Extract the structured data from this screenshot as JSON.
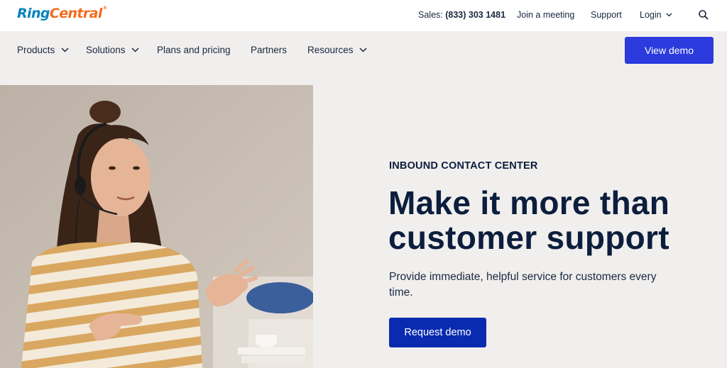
{
  "header": {
    "logo_ring": "Ring",
    "logo_central": "Central",
    "logo_reg": "®",
    "sales_label": "Sales:",
    "sales_phone": "(833) 303 1481",
    "join_meeting": "Join a meeting",
    "support": "Support",
    "login": "Login",
    "search_icon": "search-icon"
  },
  "nav": {
    "items": [
      {
        "label": "Products",
        "has_dropdown": true
      },
      {
        "label": "Solutions",
        "has_dropdown": true
      },
      {
        "label": "Plans and pricing",
        "has_dropdown": false
      },
      {
        "label": "Partners",
        "has_dropdown": false
      },
      {
        "label": "Resources",
        "has_dropdown": true
      }
    ],
    "cta": "View demo"
  },
  "hero": {
    "eyebrow": "INBOUND CONTACT CENTER",
    "headline": "Make it more than customer support",
    "subtext": "Provide immediate, helpful service for customers every time.",
    "cta": "Request demo"
  },
  "colors": {
    "brand_blue": "#0684bc",
    "brand_orange": "#f26b1d",
    "button_blue": "#2b3bdd",
    "cta_dark_blue": "#0a2bb0",
    "text_navy": "#0c1e3d",
    "background": "#f1efed"
  }
}
